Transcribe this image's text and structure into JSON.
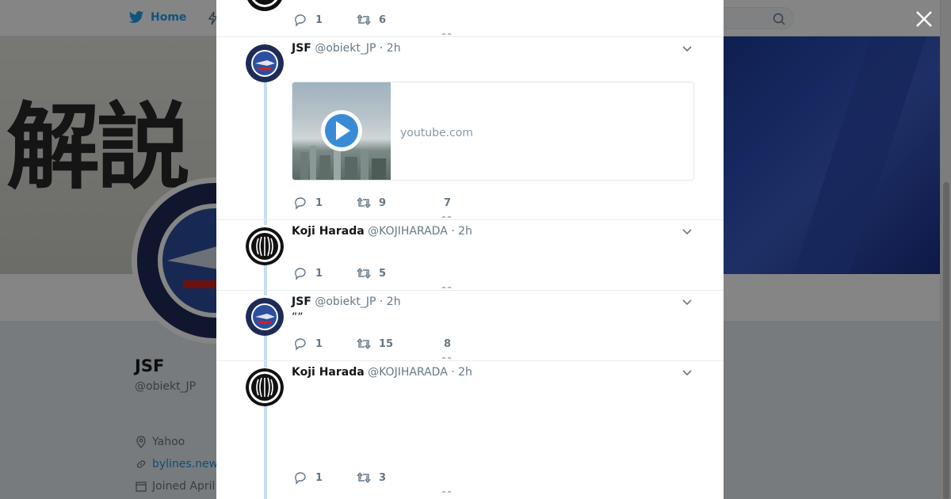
{
  "nav": {
    "home_label": "Home"
  },
  "banner": {
    "kanji": "解説"
  },
  "profile": {
    "name": "JSF",
    "handle": "@obiekt_JP",
    "location": "Yahoo",
    "website": "bylines.new",
    "joined": "Joined April"
  },
  "thread": {
    "top_actions": {
      "replies": "1",
      "retweets": "6",
      "likes": ""
    },
    "tweets": [
      {
        "name": "JSF",
        "handle": "@obiekt_JP",
        "time": "· 2h",
        "text": "",
        "card": {
          "domain": "youtube.com"
        },
        "actions": {
          "replies": "1",
          "retweets": "9",
          "likes": "7"
        }
      },
      {
        "name": "Koji Harada",
        "handle": "@KOJIHARADA",
        "time": "· 2h",
        "text": "",
        "actions": {
          "replies": "1",
          "retweets": "5",
          "likes": ""
        }
      },
      {
        "name": "JSF",
        "handle": "@obiekt_JP",
        "time": "· 2h",
        "text": "””",
        "actions": {
          "replies": "1",
          "retweets": "15",
          "likes": "8"
        }
      },
      {
        "name": "Koji Harada",
        "handle": "@KOJIHARADA",
        "time": "· 2h",
        "text": "",
        "actions": {
          "replies": "1",
          "retweets": "3",
          "likes": ""
        }
      }
    ]
  },
  "colors": {
    "brand": "#1da1f2",
    "thread_line": "#c4dfee",
    "text_secondary": "#657786"
  }
}
